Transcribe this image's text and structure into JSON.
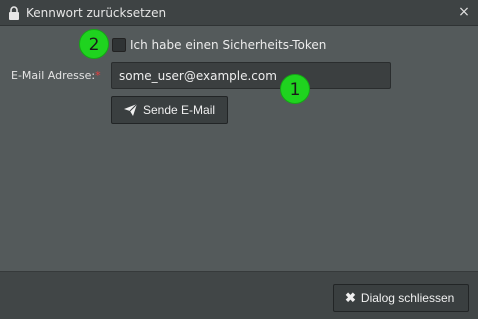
{
  "dialog": {
    "title": "Kennwort zurücksetzen",
    "title_icon": "lock-icon",
    "close_icon": "close-icon",
    "close_glyph": "×"
  },
  "form": {
    "token_checkbox_label": "Ich habe einen Sicherheits-Token",
    "token_checkbox_checked": false,
    "email_label": "E-Mail Adresse:",
    "required_mark": "*",
    "email_value": "some_user@example.com",
    "send_button_label": "Sende E-Mail",
    "send_button_icon": "paper-plane-icon"
  },
  "footer": {
    "close_button_label": "Dialog schliessen",
    "close_button_icon": "x-icon",
    "close_button_glyph": "✖"
  },
  "markers": {
    "marker_1": "1",
    "marker_2": "2",
    "marker_color": "#1fd31f"
  },
  "colors": {
    "dialog_bg": "#545a5b",
    "titlebar_bg": "#3e4344",
    "footer_bg": "#414647",
    "required": "#e83c3c"
  }
}
